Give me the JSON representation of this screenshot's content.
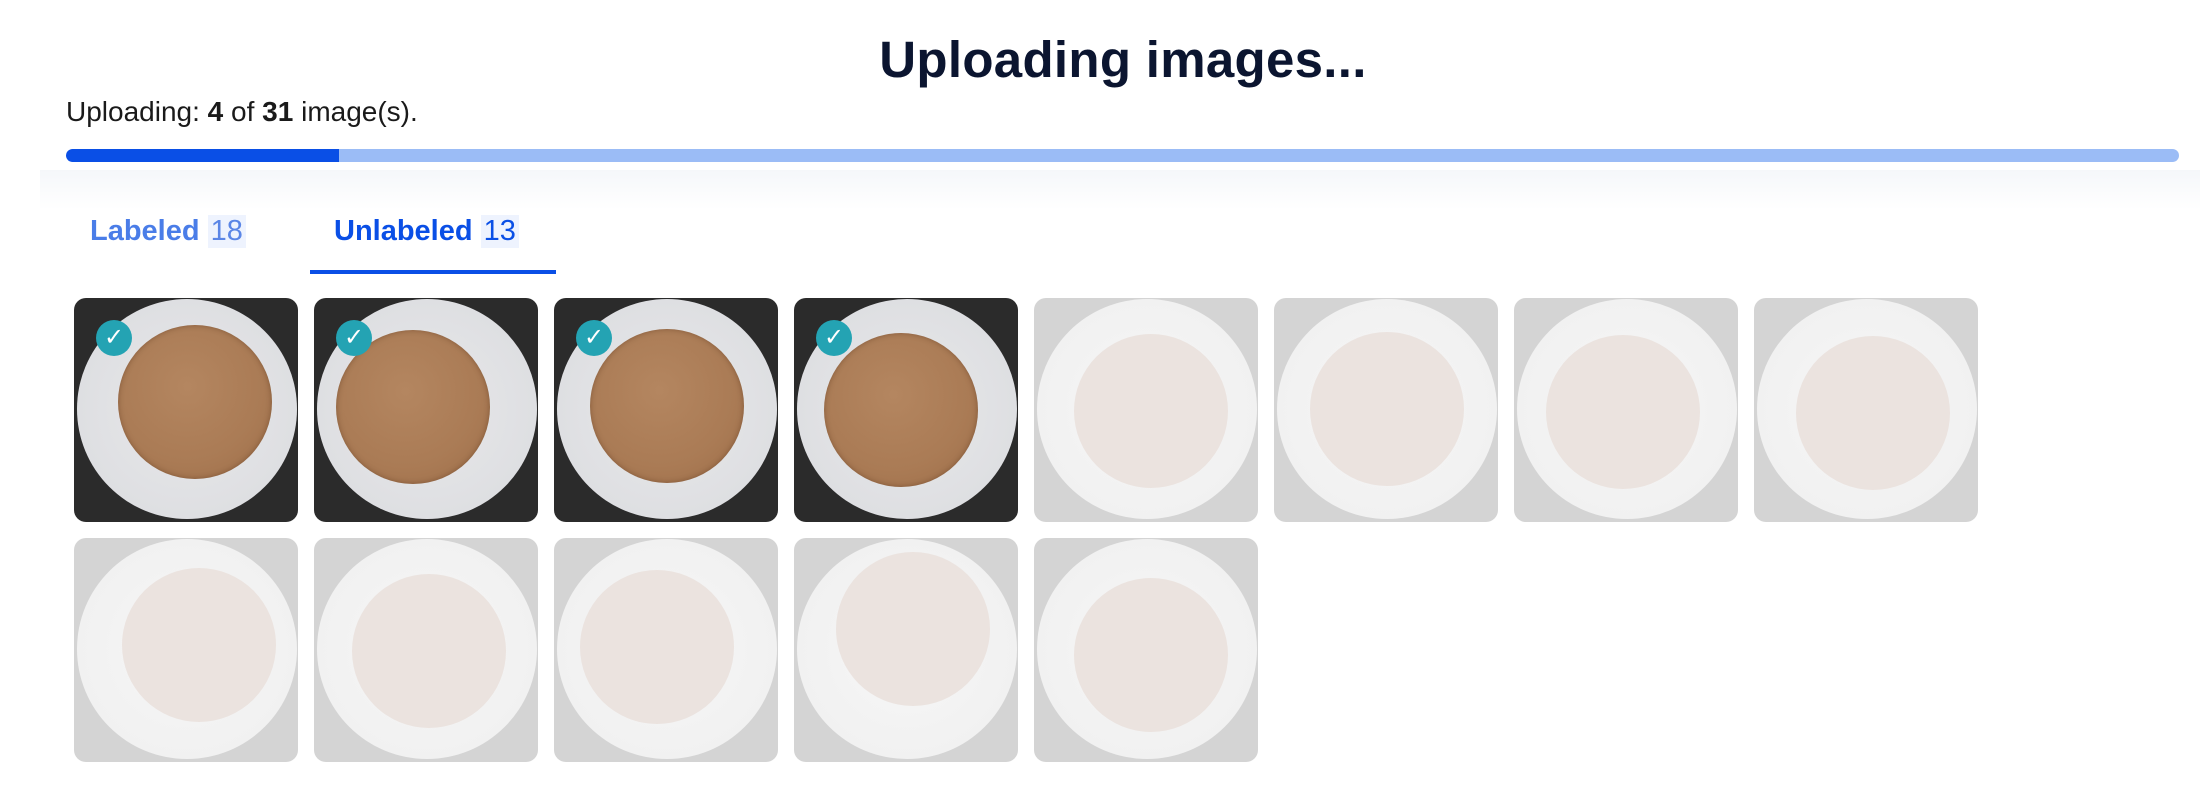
{
  "header": {
    "title": "Uploading images..."
  },
  "upload_status": {
    "prefix": "Uploading:",
    "current": "4",
    "of_word": "of",
    "total": "31",
    "suffix": "image(s).",
    "progress_fraction": 0.129,
    "track_color": "#9bbcf6",
    "fill_color": "#0a4fe6"
  },
  "tabs": [
    {
      "label": "Labeled",
      "count": "18",
      "active": false
    },
    {
      "label": "Unlabeled",
      "count": "13",
      "active": true
    }
  ],
  "images": [
    {
      "status": "uploaded",
      "checked": true
    },
    {
      "status": "uploaded",
      "checked": true
    },
    {
      "status": "uploaded",
      "checked": true
    },
    {
      "status": "uploaded",
      "checked": true
    },
    {
      "status": "pending",
      "checked": false
    },
    {
      "status": "pending",
      "checked": false
    },
    {
      "status": "pending",
      "checked": false
    },
    {
      "status": "pending",
      "checked": false
    },
    {
      "status": "pending",
      "checked": false
    },
    {
      "status": "pending",
      "checked": false
    },
    {
      "status": "pending",
      "checked": false
    },
    {
      "status": "pending",
      "checked": false
    },
    {
      "status": "pending",
      "checked": false
    }
  ],
  "icons": {
    "check": "check-circle-icon"
  },
  "colors": {
    "accent": "#0a4fe6",
    "check_badge": "#24a3b3"
  }
}
